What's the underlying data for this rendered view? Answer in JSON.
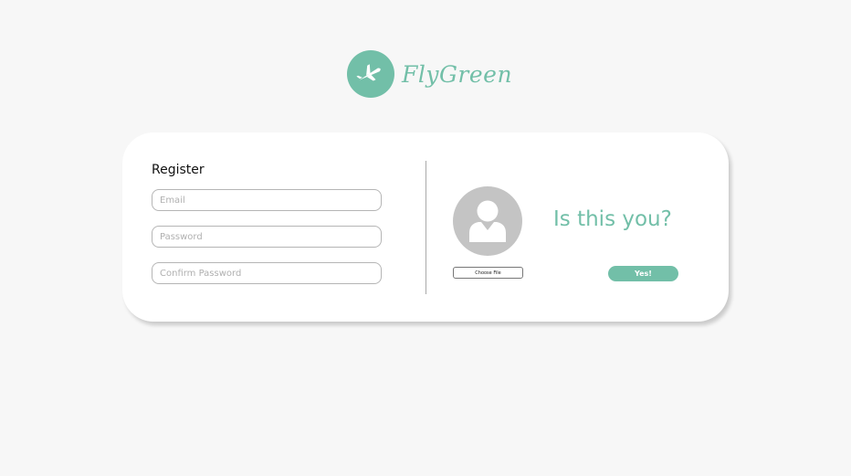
{
  "brand": {
    "name": "FlyGreen",
    "icon": "airplane-icon",
    "color": "#72bfa8"
  },
  "register": {
    "title": "Register",
    "email_placeholder": "Email",
    "password_placeholder": "Password",
    "confirm_placeholder": "Confirm Password"
  },
  "profile": {
    "avatar_icon": "user-icon",
    "choose_file_label": "Choose File",
    "question": "Is this you?",
    "confirm_label": "Yes!"
  }
}
